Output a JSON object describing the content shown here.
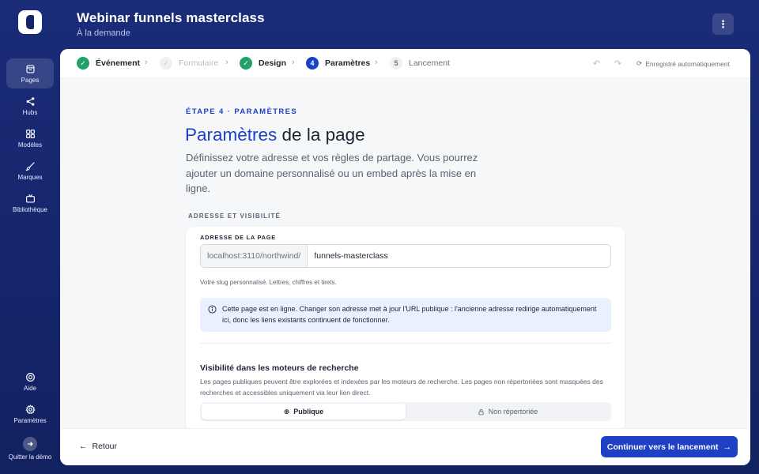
{
  "app": {
    "title": "Webinar funnels masterclass",
    "subtitle": "À la demande",
    "more_icon": "more-vertical-icon"
  },
  "sidebar": {
    "items": [
      {
        "label": "Pages",
        "icon": "pages-icon",
        "active": true
      },
      {
        "label": "Hubs",
        "icon": "share-icon",
        "active": false
      },
      {
        "label": "Modèles",
        "icon": "grid-icon",
        "active": false
      },
      {
        "label": "Marques",
        "icon": "brush-icon",
        "active": false
      },
      {
        "label": "Bibliothèque",
        "icon": "tv-icon",
        "active": false
      }
    ],
    "bottom_items": [
      {
        "label": "Aide",
        "icon": "lifebuoy-icon"
      },
      {
        "label": "Paramètres",
        "icon": "gear-icon"
      },
      {
        "label": "Quitter la démo",
        "icon": "exit-icon"
      }
    ]
  },
  "steps": [
    {
      "label": "Événement",
      "state": "done",
      "marker": "✓"
    },
    {
      "label": "Formulaire",
      "state": "faded",
      "marker": "✓"
    },
    {
      "label": "Design",
      "state": "done",
      "marker": "✓"
    },
    {
      "label": "Paramètres",
      "state": "current",
      "marker": "4"
    },
    {
      "label": "Lancement",
      "state": "todo",
      "marker": "5"
    }
  ],
  "autosave_label": "Enregistré automatiquement",
  "content": {
    "eyebrow": "ÉTAPE 4 · PARAMÈTRES",
    "headline_accent": "Paramètres",
    "headline_rest": " de la page",
    "lede": "Définissez votre adresse et vos règles de partage. Vous pourrez ajouter un domaine personnalisé ou un embed après la mise en ligne.",
    "section_label": "ADRESSE ET VISIBILITÉ",
    "address": {
      "label": "ADRESSE DE LA PAGE",
      "prefix": "localhost:3110/northwind/",
      "value": "funnels-masterclass",
      "helper": "Votre slug personnalisé. Lettres, chiffres et tirets."
    },
    "info": "Cette page est en ligne. Changer son adresse met à jour l'URL publique : l'ancienne adresse redirige automatiquement ici, donc les liens existants continuent de fonctionner.",
    "visibility": {
      "title": "Visibilité dans les moteurs de recherche",
      "description": "Les pages publiques peuvent être explorées et indexées par les moteurs de recherche. Les pages non répertoriées sont masquées des recherches et accessibles uniquement via leur lien direct.",
      "options": [
        {
          "label": "Publique",
          "icon": "globe-icon",
          "selected": true
        },
        {
          "label": "Non répertoriée",
          "icon": "lock-icon",
          "selected": false
        }
      ]
    }
  },
  "footer": {
    "back_label": "Retour",
    "continue_label": "Continuer vers le lancement"
  },
  "colors": {
    "accent": "#1d40c4",
    "success": "#22a06b",
    "sidebar_bg": "#15256b"
  }
}
